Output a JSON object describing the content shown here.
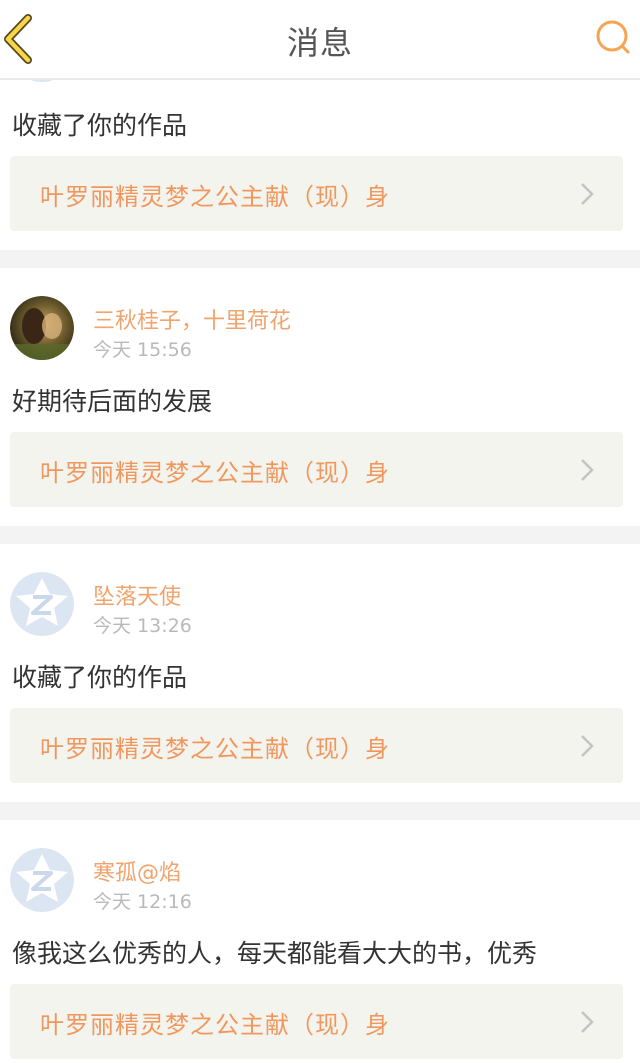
{
  "header": {
    "title": "消息",
    "back_icon": "chevron-left-icon",
    "search_icon": "search-icon",
    "accent": "#f5a552"
  },
  "messages": [
    {
      "name": "",
      "time": "",
      "comment": "收藏了你的作品",
      "work_title": "叶罗丽精灵梦之公主献（现）身",
      "avatar": "default-avatar"
    },
    {
      "name": "三秋桂子，十里荷花",
      "time": "今天 15:56",
      "comment": "好期待后面的发展",
      "work_title": "叶罗丽精灵梦之公主献（现）身",
      "avatar": "photo-avatar"
    },
    {
      "name": "坠落天使",
      "time": "今天 13:26",
      "comment": "收藏了你的作品",
      "work_title": "叶罗丽精灵梦之公主献（现）身",
      "avatar": "default-avatar"
    },
    {
      "name": "寒孤@焰",
      "time": "今天 12:16",
      "comment": "像我这么优秀的人，每天都能看大大的书，优秀",
      "work_title": "叶罗丽精灵梦之公主献（现）身",
      "avatar": "default-avatar"
    }
  ],
  "colors": {
    "name": "#f0a36c",
    "work_title": "#f0975e",
    "card_bg": "#f4f4ee",
    "separator": "#f3f3f3"
  }
}
